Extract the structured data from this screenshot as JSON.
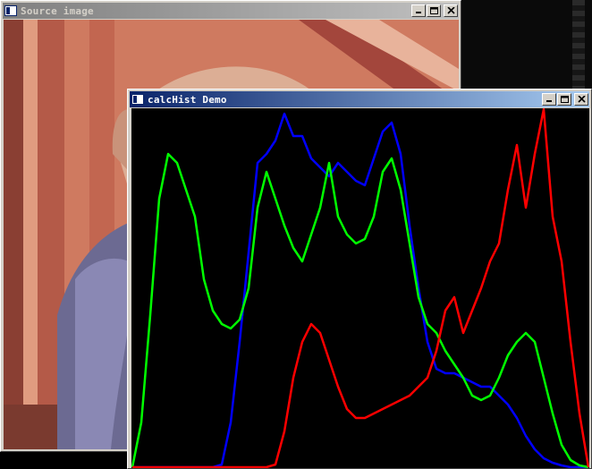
{
  "windows": {
    "source": {
      "title": "Source image"
    },
    "histogram": {
      "title": "calcHist Demo"
    }
  },
  "icons": {
    "app": "window-app-icon",
    "minimize": "minimize-icon",
    "maximize": "maximize-icon",
    "close": "close-icon"
  },
  "chart_data": {
    "type": "line",
    "x_range": [
      0,
      255
    ],
    "y_range": [
      0,
      400
    ],
    "grid": false,
    "background": "#000000",
    "series": [
      {
        "color": "#0000ff",
        "x": [
          0,
          20,
          40,
          45,
          50,
          55,
          60,
          65,
          70,
          75,
          80,
          85,
          90,
          95,
          100,
          105,
          110,
          115,
          120,
          125,
          130,
          135,
          140,
          145,
          150,
          155,
          160,
          165,
          170,
          175,
          180,
          185,
          190,
          195,
          200,
          205,
          210,
          215,
          220,
          225,
          230,
          235,
          240,
          245,
          250,
          255
        ],
        "values": [
          0,
          0,
          0,
          0,
          3,
          50,
          140,
          240,
          340,
          350,
          365,
          395,
          370,
          370,
          345,
          335,
          325,
          340,
          330,
          320,
          315,
          345,
          375,
          385,
          350,
          270,
          200,
          140,
          110,
          105,
          105,
          100,
          95,
          90,
          90,
          80,
          70,
          55,
          35,
          20,
          10,
          5,
          2,
          0,
          0,
          0
        ]
      },
      {
        "color": "#00ff00",
        "x": [
          0,
          5,
          10,
          15,
          20,
          25,
          30,
          35,
          40,
          45,
          50,
          55,
          60,
          65,
          70,
          75,
          80,
          85,
          90,
          95,
          100,
          105,
          110,
          115,
          120,
          125,
          130,
          135,
          140,
          145,
          150,
          155,
          160,
          165,
          170,
          175,
          180,
          185,
          190,
          195,
          200,
          205,
          210,
          215,
          220,
          225,
          230,
          235,
          240,
          245,
          250,
          255
        ],
        "values": [
          0,
          50,
          170,
          300,
          350,
          340,
          310,
          280,
          210,
          175,
          160,
          155,
          165,
          200,
          290,
          330,
          300,
          270,
          245,
          230,
          260,
          290,
          340,
          280,
          260,
          250,
          255,
          280,
          330,
          345,
          310,
          250,
          190,
          160,
          150,
          130,
          115,
          100,
          80,
          75,
          80,
          100,
          125,
          140,
          150,
          140,
          100,
          60,
          25,
          8,
          2,
          0
        ]
      },
      {
        "color": "#ff0000",
        "x": [
          0,
          40,
          60,
          70,
          75,
          80,
          85,
          90,
          95,
          100,
          105,
          110,
          115,
          120,
          125,
          130,
          135,
          140,
          145,
          150,
          155,
          160,
          165,
          170,
          175,
          180,
          185,
          190,
          195,
          200,
          205,
          210,
          215,
          220,
          225,
          230,
          235,
          240,
          245,
          250,
          255
        ],
        "values": [
          0,
          0,
          0,
          0,
          0,
          3,
          40,
          100,
          140,
          160,
          150,
          120,
          90,
          65,
          55,
          55,
          60,
          65,
          70,
          75,
          80,
          90,
          100,
          130,
          175,
          190,
          150,
          175,
          200,
          230,
          250,
          310,
          360,
          290,
          350,
          400,
          280,
          230,
          140,
          60,
          0
        ]
      }
    ]
  }
}
